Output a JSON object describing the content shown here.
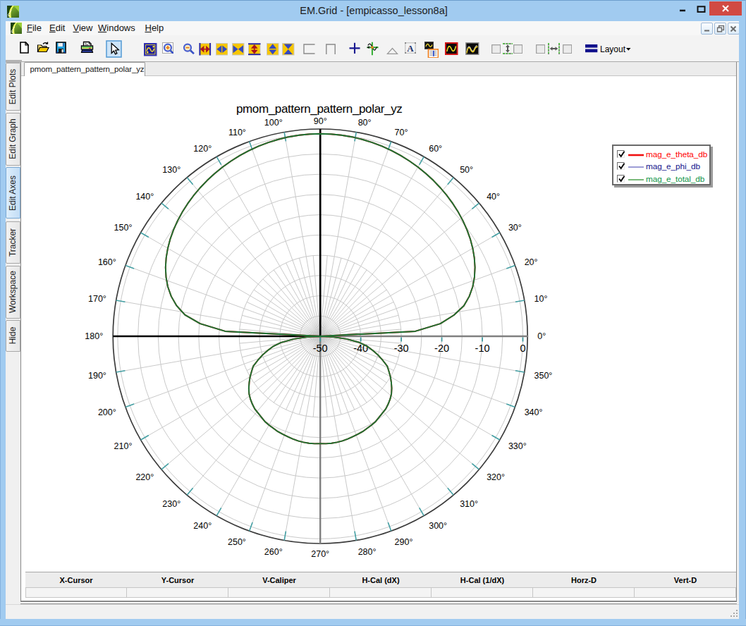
{
  "window": {
    "title": "EM.Grid - [empicasso_lesson8a]",
    "controls": {
      "minimize": "minimize",
      "maximize": "maximize",
      "close": "close"
    }
  },
  "menu": {
    "items": [
      {
        "label": "File",
        "accel": "F"
      },
      {
        "label": "Edit",
        "accel": "E"
      },
      {
        "label": "View",
        "accel": "V"
      },
      {
        "label": "Windows",
        "accel": "W"
      },
      {
        "label": "Help",
        "accel": "H"
      }
    ]
  },
  "toolbar": {
    "layout_label": "Layout",
    "icons": [
      "new-document",
      "open-file",
      "save",
      "print",
      "pointer-select",
      "fit-plot",
      "zoom-in",
      "zoom-out",
      "expand-horizontal",
      "shrink-horizontal",
      "collapse-horizontal",
      "expand-vertical",
      "shrink-vertical",
      "collapse-vertical",
      "frame-open-right",
      "frame-open-bottom",
      "crosshair",
      "tracker-axes",
      "triangle-marker",
      "text-label",
      "report-notebook",
      "plot-red-frame",
      "plot-dual-trace",
      "track-vertical-group",
      "track-horizontal-group",
      "layout-menu"
    ]
  },
  "sidebar": {
    "tabs": [
      {
        "label": "Edit Plots",
        "selected": false
      },
      {
        "label": "Edit Graph",
        "selected": false
      },
      {
        "label": "Edit Axes",
        "selected": true
      },
      {
        "label": "Tracker",
        "selected": false
      },
      {
        "label": "Workspace",
        "selected": false
      },
      {
        "label": "Hide",
        "selected": false
      }
    ]
  },
  "document_tab": {
    "label": "pmom_pattern_pattern_polar_yz"
  },
  "chart_data": {
    "type": "polar-line",
    "title": "pmom_pattern_pattern_polar_yz",
    "angle_unit": "deg",
    "angle_labels": [
      "0°",
      "10°",
      "20°",
      "30°",
      "40°",
      "50°",
      "60°",
      "70°",
      "80°",
      "90°",
      "100°",
      "110°",
      "120°",
      "130°",
      "140°",
      "150°",
      "160°",
      "170°",
      "180°",
      "190°",
      "200°",
      "210°",
      "220°",
      "230°",
      "240°",
      "250°",
      "260°",
      "270°",
      "280°",
      "290°",
      "300°",
      "310°",
      "320°",
      "330°",
      "340°",
      "350°"
    ],
    "radial_ticks": [
      -50,
      -40,
      -30,
      -20,
      -10,
      0
    ],
    "radial_tick_labels": [
      "-50",
      "-40",
      "-30",
      "-20",
      "-10",
      "0"
    ],
    "r_min": -50,
    "r_max": 0,
    "grid": {
      "circle_step_db": 5,
      "spoke_major_deg": 10,
      "spoke_minor_deg": 5
    },
    "theta_step_deg": 3,
    "series": [
      {
        "name": "mag_e_theta_db",
        "color": "#e01010",
        "values_db": [
          -50.0,
          -26.5,
          -20.2,
          -16.6,
          -13.76,
          -11.92,
          -10.44,
          -9.23,
          -8.2,
          -7.32,
          -6.55,
          -5.86,
          -5.25,
          -4.69,
          -4.18,
          -3.71,
          -3.27,
          -2.86,
          -2.47,
          -2.11,
          -1.77,
          -1.46,
          -1.17,
          -0.91,
          -0.68,
          -0.48,
          -0.31,
          -0.17,
          -0.08,
          -0.02,
          -0.0,
          -0.02,
          -0.08,
          -0.17,
          -0.31,
          -0.48,
          -0.68,
          -0.91,
          -1.17,
          -1.46,
          -1.77,
          -2.11,
          -2.47,
          -2.86,
          -3.27,
          -3.71,
          -4.18,
          -4.69,
          -5.25,
          -5.86,
          -6.55,
          -7.32,
          -8.2,
          -9.23,
          -10.44,
          -11.92,
          -13.76,
          -16.18,
          -20.2,
          -26.5,
          -50.0,
          -47.0,
          -43.5,
          -40.2,
          -38.2,
          -36.6,
          -35.0,
          -33.5,
          -31.9,
          -31.0,
          -30.0,
          -29.1,
          -28.2,
          -27.4,
          -26.8,
          -26.3,
          -25.85,
          -25.6,
          -25.3,
          -24.9,
          -24.7,
          -24.5,
          -24.25,
          -24.1,
          -23.95,
          -23.75,
          -23.6,
          -23.5,
          -23.45,
          -23.45,
          -23.5,
          -23.45,
          -23.45,
          -23.5,
          -23.6,
          -23.75,
          -23.95,
          -24.1,
          -24.25,
          -24.5,
          -24.7,
          -24.9,
          -25.3,
          -25.6,
          -25.85,
          -26.3,
          -26.8,
          -27.4,
          -28.2,
          -29.1,
          -30.0,
          -31.0,
          -31.9,
          -33.5,
          -35.0,
          -36.6,
          -38.2,
          -40.2,
          -43.5,
          -47.0,
          -50.0
        ]
      },
      {
        "name": "mag_e_phi_db",
        "color": "#8585cc",
        "values_db": [
          -50.0,
          -50.0,
          -50.0,
          -50.0,
          -50.0,
          -50.0,
          -50.0,
          -50.0,
          -50.0,
          -50.0,
          -50.0,
          -50.0,
          -50.0,
          -50.0,
          -50.0,
          -50.0,
          -50.0,
          -50.0,
          -50.0,
          -50.0,
          -50.0,
          -50.0,
          -50.0,
          -50.0,
          -50.0,
          -50.0,
          -50.0,
          -50.0,
          -50.0,
          -50.0,
          -50.0,
          -50.0,
          -50.0,
          -50.0,
          -50.0,
          -50.0,
          -50.0,
          -50.0,
          -50.0,
          -50.0,
          -50.0,
          -50.0,
          -50.0,
          -50.0,
          -50.0,
          -50.0,
          -50.0,
          -50.0,
          -50.0,
          -50.0,
          -50.0,
          -50.0,
          -50.0,
          -50.0,
          -50.0,
          -50.0,
          -50.0,
          -50.0,
          -50.0,
          -50.0,
          -50.0,
          -50.0,
          -50.0,
          -50.0,
          -50.0,
          -50.0,
          -50.0,
          -50.0,
          -50.0,
          -50.0,
          -50.0,
          -50.0,
          -50.0,
          -50.0,
          -50.0,
          -50.0,
          -50.0,
          -50.0,
          -50.0,
          -50.0,
          -50.0,
          -50.0,
          -50.0,
          -50.0,
          -50.0,
          -50.0,
          -50.0,
          -50.0,
          -50.0,
          -50.0,
          -50.0,
          -50.0,
          -50.0,
          -50.0,
          -50.0,
          -50.0,
          -50.0,
          -50.0,
          -50.0,
          -50.0,
          -50.0,
          -50.0,
          -50.0,
          -50.0,
          -50.0,
          -50.0,
          -50.0,
          -50.0,
          -50.0,
          -50.0,
          -50.0,
          -50.0,
          -50.0,
          -50.0,
          -50.0,
          -50.0,
          -50.0,
          -50.0,
          -50.0,
          -50.0,
          -50.0
        ]
      },
      {
        "name": "mag_e_total_db",
        "color": "#1b7434",
        "values_db": [
          -50.0,
          -26.5,
          -20.2,
          -16.6,
          -13.76,
          -11.92,
          -10.44,
          -9.23,
          -8.2,
          -7.32,
          -6.55,
          -5.86,
          -5.25,
          -4.69,
          -4.18,
          -3.71,
          -3.27,
          -2.86,
          -2.47,
          -2.11,
          -1.77,
          -1.46,
          -1.17,
          -0.91,
          -0.68,
          -0.48,
          -0.31,
          -0.17,
          -0.08,
          -0.02,
          -0.0,
          -0.02,
          -0.08,
          -0.17,
          -0.31,
          -0.48,
          -0.68,
          -0.91,
          -1.17,
          -1.46,
          -1.77,
          -2.11,
          -2.47,
          -2.86,
          -3.27,
          -3.71,
          -4.18,
          -4.69,
          -5.25,
          -5.86,
          -6.55,
          -7.32,
          -8.2,
          -9.23,
          -10.44,
          -11.92,
          -13.76,
          -16.18,
          -20.2,
          -26.5,
          -50.0,
          -47.0,
          -43.5,
          -40.2,
          -38.2,
          -36.6,
          -35.0,
          -33.5,
          -31.9,
          -31.0,
          -30.0,
          -29.1,
          -28.2,
          -27.4,
          -26.8,
          -26.3,
          -25.85,
          -25.6,
          -25.3,
          -24.9,
          -24.7,
          -24.5,
          -24.25,
          -24.1,
          -23.95,
          -23.75,
          -23.6,
          -23.5,
          -23.45,
          -23.45,
          -23.5,
          -23.45,
          -23.45,
          -23.5,
          -23.6,
          -23.75,
          -23.95,
          -24.1,
          -24.25,
          -24.5,
          -24.7,
          -24.9,
          -25.3,
          -25.6,
          -25.85,
          -26.3,
          -26.8,
          -27.4,
          -28.2,
          -29.1,
          -30.0,
          -31.0,
          -31.9,
          -33.5,
          -35.0,
          -36.6,
          -38.2,
          -40.2,
          -43.5,
          -47.0,
          -50.0
        ]
      }
    ]
  },
  "legend": {
    "entries": [
      {
        "label": "mag_e_theta_db",
        "checked": true,
        "line_color": "#f01010",
        "text_color": "#ff0000",
        "line_width": 2.6
      },
      {
        "label": "mag_e_phi_db",
        "checked": true,
        "line_color": "#8585cc",
        "text_color": "#12128c",
        "line_width": 1.6
      },
      {
        "label": "mag_e_total_db",
        "checked": true,
        "line_color": "#58a858",
        "text_color": "#0e9448",
        "line_width": 1.6
      }
    ]
  },
  "cursor_table": {
    "headers": [
      "X-Cursor",
      "Y-Cursor",
      "V-Caliper",
      "H-Cal (dX)",
      "H-Cal (1/dX)",
      "Horz-D",
      "Vert-D"
    ],
    "values": [
      "",
      "",
      "",
      "",
      "",
      "",
      ""
    ]
  }
}
